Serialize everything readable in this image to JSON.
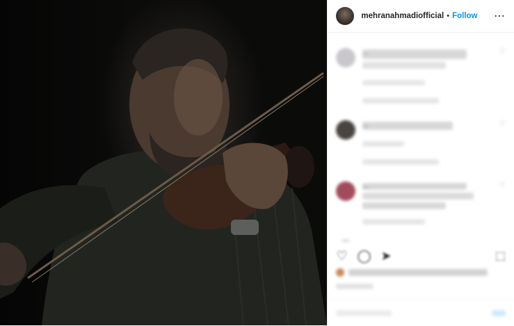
{
  "header": {
    "username": "mehranahmadiofficial",
    "separator": "•",
    "follow_label": "Follow",
    "more_icon": "⋯"
  },
  "colors": {
    "follow_blue": "#0095f6",
    "text": "#262626",
    "muted": "#8e8e8e"
  },
  "comments": [
    {
      "text": "...",
      "meta": "...",
      "replies": "..."
    },
    {
      "text": "...",
      "meta": "...",
      "replies": "..."
    },
    {
      "text": "...",
      "meta": "...",
      "replies": ""
    }
  ],
  "icons": {
    "like": "heart-icon",
    "comment": "comment-icon",
    "share": "share-icon",
    "save": "bookmark-icon"
  }
}
